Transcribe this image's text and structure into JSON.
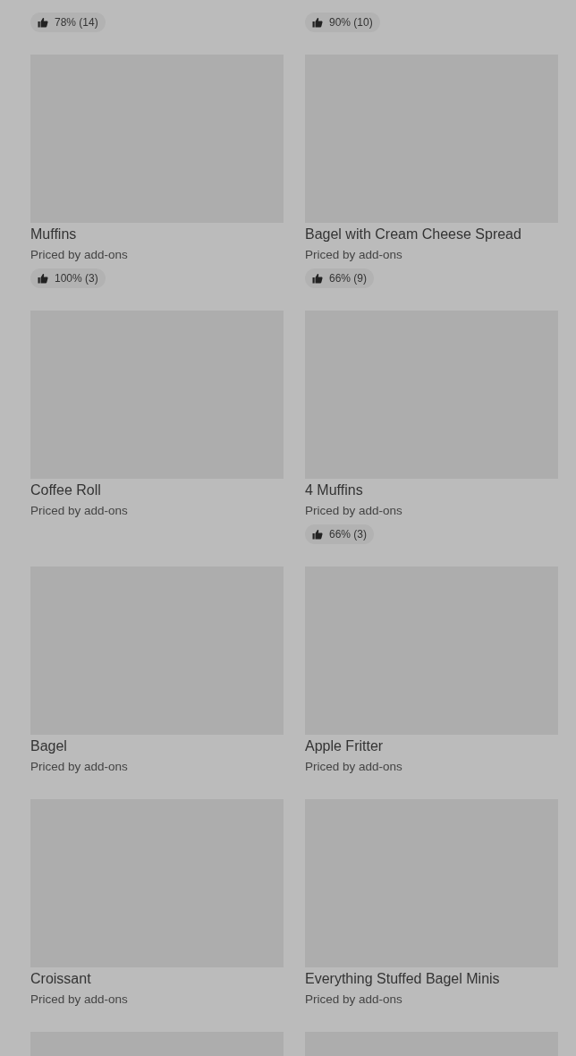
{
  "items": [
    {
      "rating": "78% (14)"
    },
    {
      "rating": "90% (10)"
    },
    {
      "kind": "picture",
      "title": "Muffins",
      "subtitle": "Priced by add-ons",
      "rating": "100% (3)"
    },
    {
      "kind": "picture",
      "title": "Bagel with Cream Cheese Spread",
      "subtitle": "Priced by add-ons",
      "rating": "66% (9)"
    },
    {
      "kind": "picture",
      "title": "Coffee Roll",
      "subtitle": "Priced by add-ons"
    },
    {
      "kind": "picture",
      "title": "4 Muffins",
      "subtitle": "Priced by add-ons",
      "rating": "66% (3)"
    },
    {
      "kind": "picture",
      "title": "Bagel",
      "subtitle": "Priced by add-ons"
    },
    {
      "kind": "picture",
      "title": "Apple Fritter",
      "subtitle": "Priced by add-ons"
    },
    {
      "kind": "picture",
      "title": "Croissant",
      "subtitle": "Priced by add-ons"
    },
    {
      "kind": "picture",
      "title": "Everything Stuffed Bagel Minis",
      "subtitle": "Priced by add-ons"
    },
    {
      "kind": "picture"
    },
    {
      "kind": "picture"
    }
  ]
}
